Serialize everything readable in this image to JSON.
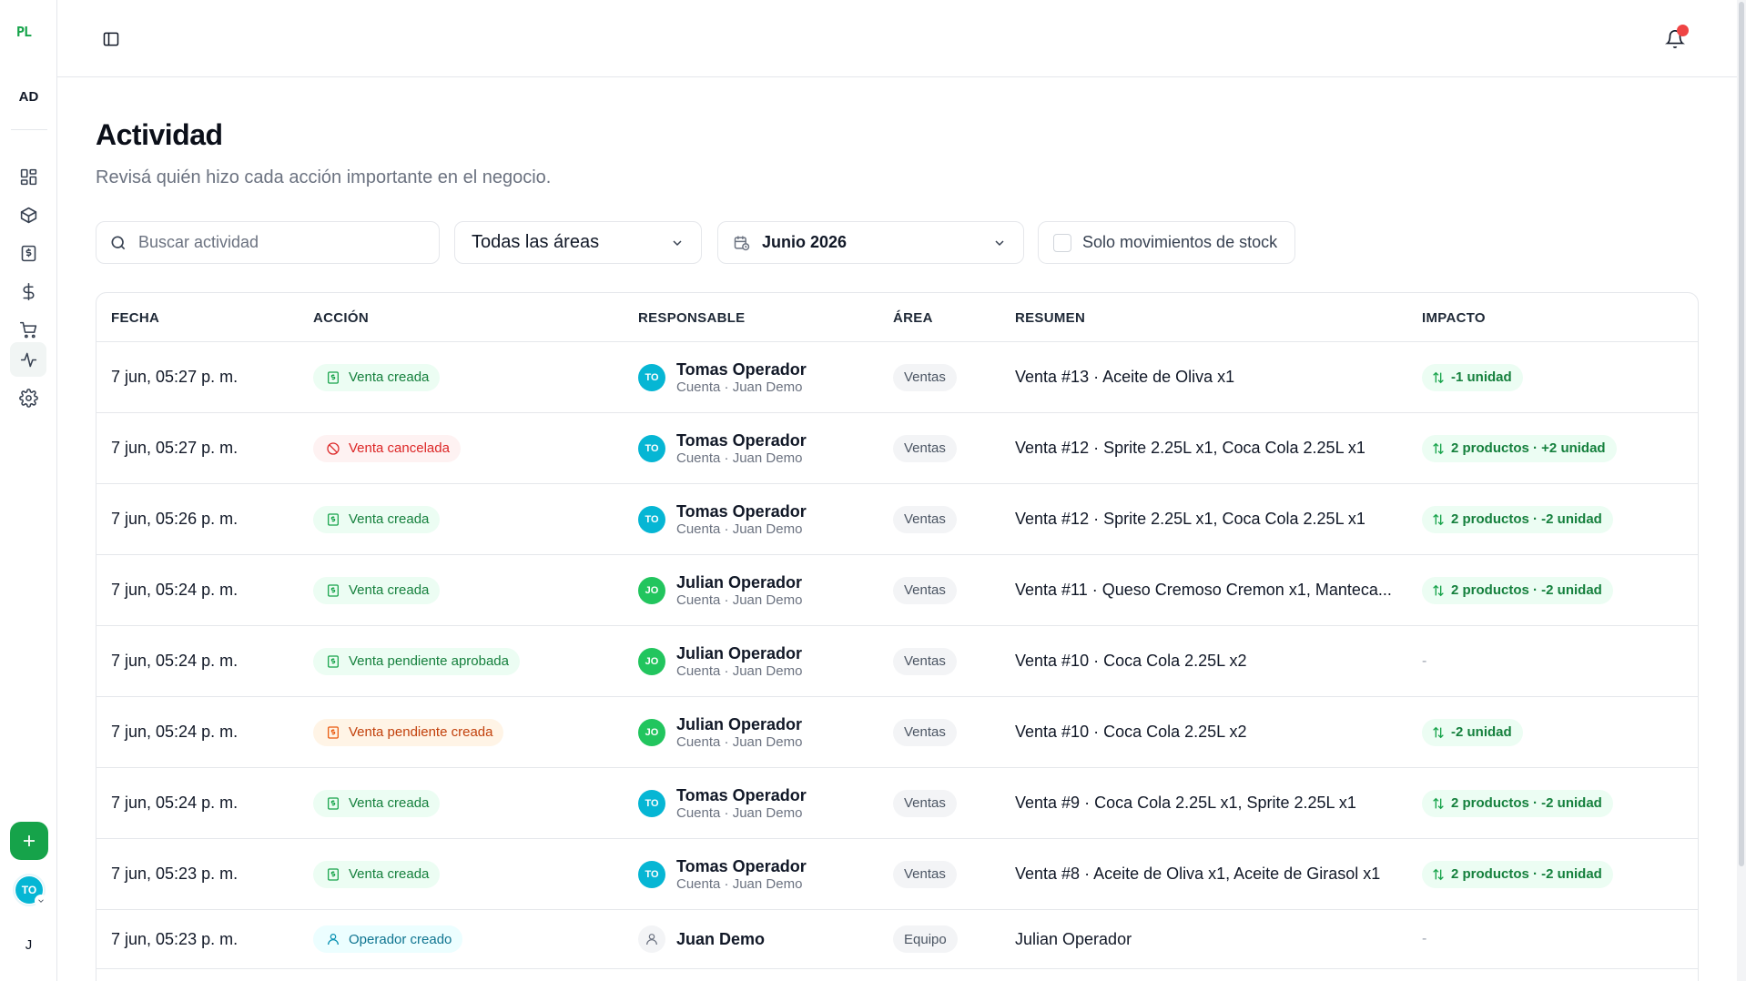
{
  "brand": {
    "logo_text": "PL"
  },
  "sidebar": {
    "workspace_initials": "AD",
    "nav": [
      {
        "name": "dashboard",
        "icon": "layout-grid-icon"
      },
      {
        "name": "products",
        "icon": "box-icon"
      },
      {
        "name": "receipts",
        "icon": "receipt-icon"
      },
      {
        "name": "finances",
        "icon": "dollar-icon"
      },
      {
        "name": "sales",
        "icon": "cart-icon"
      },
      {
        "name": "activity",
        "icon": "activity-icon",
        "active": true
      },
      {
        "name": "settings",
        "icon": "gear-icon"
      }
    ],
    "user_initials": "TO",
    "bottom_letter": "J"
  },
  "header": {
    "notifications": true
  },
  "page": {
    "title": "Actividad",
    "subtitle": "Revisá quién hizo cada acción importante en el negocio."
  },
  "filters": {
    "search_placeholder": "Buscar actividad",
    "search_value": "",
    "area_selected": "Todas las áreas",
    "month_selected": "Junio 2026",
    "stock_only_label": "Solo movimientos de stock",
    "stock_only_checked": false
  },
  "table": {
    "headers": [
      "FECHA",
      "ACCIÓN",
      "RESPONSABLE",
      "ÁREA",
      "RESUMEN",
      "IMPACTO"
    ],
    "rows": [
      {
        "date": "7 jun, 05:27 p. m.",
        "action": "Venta creada",
        "action_tone": "green",
        "action_icon": "receipt-icon",
        "avatar": "TO",
        "name": "Tomas Operador",
        "sub": "Cuenta · Juan Demo",
        "area": "Ventas",
        "summary": "Venta #13 · Aceite de Oliva x1",
        "impact": "-1 unidad"
      },
      {
        "date": "7 jun, 05:27 p. m.",
        "action": "Venta cancelada",
        "action_tone": "red",
        "action_icon": "ban-icon",
        "avatar": "TO",
        "name": "Tomas Operador",
        "sub": "Cuenta · Juan Demo",
        "area": "Ventas",
        "summary": "Venta #12 · Sprite 2.25L x1, Coca Cola 2.25L x1",
        "impact": "2 productos · +2 unidad"
      },
      {
        "date": "7 jun, 05:26 p. m.",
        "action": "Venta creada",
        "action_tone": "green",
        "action_icon": "receipt-icon",
        "avatar": "TO",
        "name": "Tomas Operador",
        "sub": "Cuenta · Juan Demo",
        "area": "Ventas",
        "summary": "Venta #12 · Sprite 2.25L x1, Coca Cola 2.25L x1",
        "impact": "2 productos · -2 unidad"
      },
      {
        "date": "7 jun, 05:24 p. m.",
        "action": "Venta creada",
        "action_tone": "green",
        "action_icon": "receipt-icon",
        "avatar": "JO",
        "name": "Julian Operador",
        "sub": "Cuenta · Juan Demo",
        "area": "Ventas",
        "summary": "Venta #11 · Queso Cremoso Cremon x1, Manteca...",
        "impact": "2 productos · -2 unidad"
      },
      {
        "date": "7 jun, 05:24 p. m.",
        "action": "Venta pendiente aprobada",
        "action_tone": "green",
        "action_icon": "receipt-icon",
        "avatar": "JO",
        "name": "Julian Operador",
        "sub": "Cuenta · Juan Demo",
        "area": "Ventas",
        "summary": "Venta #10 · Coca Cola 2.25L x2",
        "impact": "-"
      },
      {
        "date": "7 jun, 05:24 p. m.",
        "action": "Venta pendiente creada",
        "action_tone": "orange",
        "action_icon": "receipt-icon",
        "avatar": "JO",
        "name": "Julian Operador",
        "sub": "Cuenta · Juan Demo",
        "area": "Ventas",
        "summary": "Venta #10 · Coca Cola 2.25L x2",
        "impact": "-2 unidad"
      },
      {
        "date": "7 jun, 05:24 p. m.",
        "action": "Venta creada",
        "action_tone": "green",
        "action_icon": "receipt-icon",
        "avatar": "TO",
        "name": "Tomas Operador",
        "sub": "Cuenta · Juan Demo",
        "area": "Ventas",
        "summary": "Venta #9 · Coca Cola 2.25L x1, Sprite 2.25L x1",
        "impact": "2 productos · -2 unidad"
      },
      {
        "date": "7 jun, 05:23 p. m.",
        "action": "Venta creada",
        "action_tone": "green",
        "action_icon": "receipt-icon",
        "avatar": "TO",
        "name": "Tomas Operador",
        "sub": "Cuenta · Juan Demo",
        "area": "Ventas",
        "summary": "Venta #8 · Aceite de Oliva x1, Aceite de Girasol x1",
        "impact": "2 productos · -2 unidad"
      },
      {
        "date": "7 jun, 05:23 p. m.",
        "action": "Operador creado",
        "action_tone": "blue",
        "action_icon": "user-icon",
        "avatar": "person",
        "name": "Juan Demo",
        "sub": "",
        "area": "Equipo",
        "summary": "Julian Operador",
        "impact": "-"
      }
    ]
  },
  "colors": {
    "brand": "#16a34a",
    "accent_cyan": "#06b6d4",
    "accent_green": "#22c55e",
    "danger": "#ef4444"
  }
}
